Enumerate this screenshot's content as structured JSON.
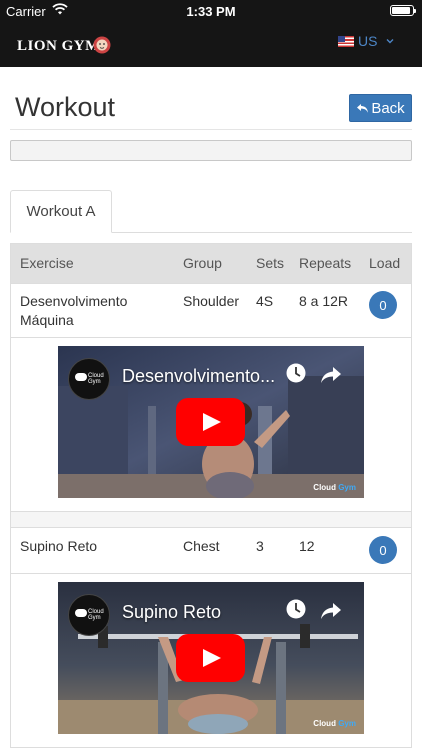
{
  "status": {
    "carrier": "Carrier",
    "time": "1:33 PM"
  },
  "header": {
    "logo": "LION GYM",
    "language": "US"
  },
  "page": {
    "title": "Workout",
    "back_label": "Back",
    "progress": 0
  },
  "tabs": [
    {
      "label": "Workout A"
    }
  ],
  "table": {
    "columns": [
      "Exercise",
      "Group",
      "Sets",
      "Repeats",
      "Load"
    ],
    "rows": [
      {
        "exercise_line1": "Desenvolvimento",
        "exercise_line2": "Máquina",
        "group": "Shoulder",
        "sets": "4S",
        "repeats": "8 a 12R",
        "load": "0",
        "video": {
          "title": "Desenvolvimento...",
          "channel": "Cloud Gym",
          "brand_a": "Cloud",
          "brand_b": "Gym"
        }
      },
      {
        "exercise_line1": "Supino Reto",
        "exercise_line2": "",
        "group": "Chest",
        "sets": "3",
        "repeats": "12",
        "load": "0",
        "video": {
          "title": "Supino Reto",
          "channel": "Cloud Gym",
          "brand_a": "Cloud",
          "brand_b": "Gym"
        }
      }
    ]
  },
  "colors": {
    "accent": "#3a78b8",
    "youtube_red": "#ff0000",
    "header_bg": "#151515"
  }
}
